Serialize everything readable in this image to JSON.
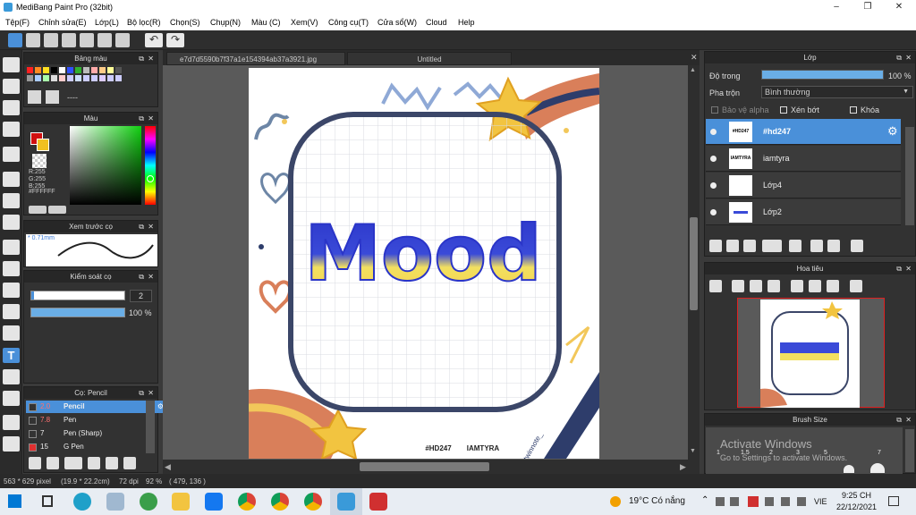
{
  "window": {
    "title": "MediBang Paint Pro (32bit)"
  },
  "menu": [
    "Tệp(F)",
    "Chỉnh sửa(E)",
    "Lớp(L)",
    "Bộ lọc(R)",
    "Chọn(S)",
    "Chụp(N)",
    "Màu (C)",
    "Xem(V)",
    "Công cụ(T)",
    "Cửa sổ(W)",
    "Cloud",
    "Help"
  ],
  "palette_panel": {
    "title": "Bảng màu",
    "swatch_colors": [
      "#ff2020",
      "#ff8a20",
      "#ffe020",
      "#000000",
      "#ffffff",
      "#3050ff",
      "#30b030",
      "#bbbbbb",
      "#ffaaaa",
      "#ffcc88",
      "#ffff99",
      "#555555",
      "#999999",
      "#aaccff",
      "#aaffaa",
      "#dddddd",
      "#ffcccc",
      "#ccccff",
      "#ccddff",
      "#ccccff",
      "#ccccff",
      "#ddccff",
      "#ccccff",
      "#ccccff"
    ],
    "dash": "----"
  },
  "color_panel": {
    "title": "Màu",
    "r": "R:255",
    "g": "G:255",
    "b": "B:255",
    "hex": "#FFFFFF",
    "primary": "#d01010",
    "secondary": "#f0c020"
  },
  "brush_preview": {
    "title": "Xem trước cọ",
    "size": "0.71mm"
  },
  "brush_control": {
    "title": "Kiểm soát cọ",
    "size_value": "2",
    "opacity_value": "100 %"
  },
  "brush_list": {
    "title": "Cọ: Pencil",
    "items": [
      {
        "size": "2.0",
        "name": "Pencil",
        "color": "#333333",
        "size_color": "#ff7070"
      },
      {
        "size": "7.8",
        "name": "Pen",
        "color": "#333333",
        "size_color": "#ff7070"
      },
      {
        "size": "7",
        "name": "Pen (Sharp)",
        "color": "#333333",
        "size_color": "#eeeeee"
      },
      {
        "size": "15",
        "name": "G Pen",
        "color": "#e03030",
        "size_color": "#eeeeee"
      }
    ]
  },
  "tabs": [
    "e7d7d5590b7f37a1e154394ab37a3921.jpg",
    "Untitled"
  ],
  "artwork": {
    "word": "Mood",
    "credits": [
      "#HD247",
      "IAMTYRA",
      "@twinnote_"
    ]
  },
  "layer_panel": {
    "title": "Lớp",
    "opacity_label": "Độ trong",
    "opacity_value": "100 %",
    "opacity_fraction": 1.0,
    "blend_label": "Pha trộn",
    "blend_value": "Bình thường",
    "alpha_label": "Bảo vệ alpha",
    "clip_label": "Xén bớt",
    "lock_label": "Khóa",
    "layers": [
      {
        "name": "#hd247",
        "thumb": "#HD247"
      },
      {
        "name": "iamtyra",
        "thumb": "IAMTYRA"
      },
      {
        "name": "Lớp4",
        "thumb": ""
      },
      {
        "name": "Lớp2",
        "thumb": ""
      }
    ]
  },
  "navigator": {
    "title": "Hoa tiêu"
  },
  "brush_size": {
    "title": "Brush Size",
    "values": [
      "1",
      "1.5",
      "2",
      "3",
      "5",
      "7"
    ]
  },
  "watermark": {
    "line1": "Activate Windows",
    "line2": "Go to Settings to activate Windows."
  },
  "status": {
    "size": "563 * 629 pixel",
    "physical": "(19.9 * 22.2cm)",
    "dpi": "72 dpi",
    "zoom": "92 %",
    "coords": "( 479, 136 )"
  },
  "taskbar": {
    "weather": "19°C  Có nắng",
    "lang": "VIE",
    "time": "9:25 CH",
    "date": "22/12/2021"
  },
  "colors": {
    "accent": "#4a90d9",
    "panel": "#323232",
    "header": "#272727"
  }
}
